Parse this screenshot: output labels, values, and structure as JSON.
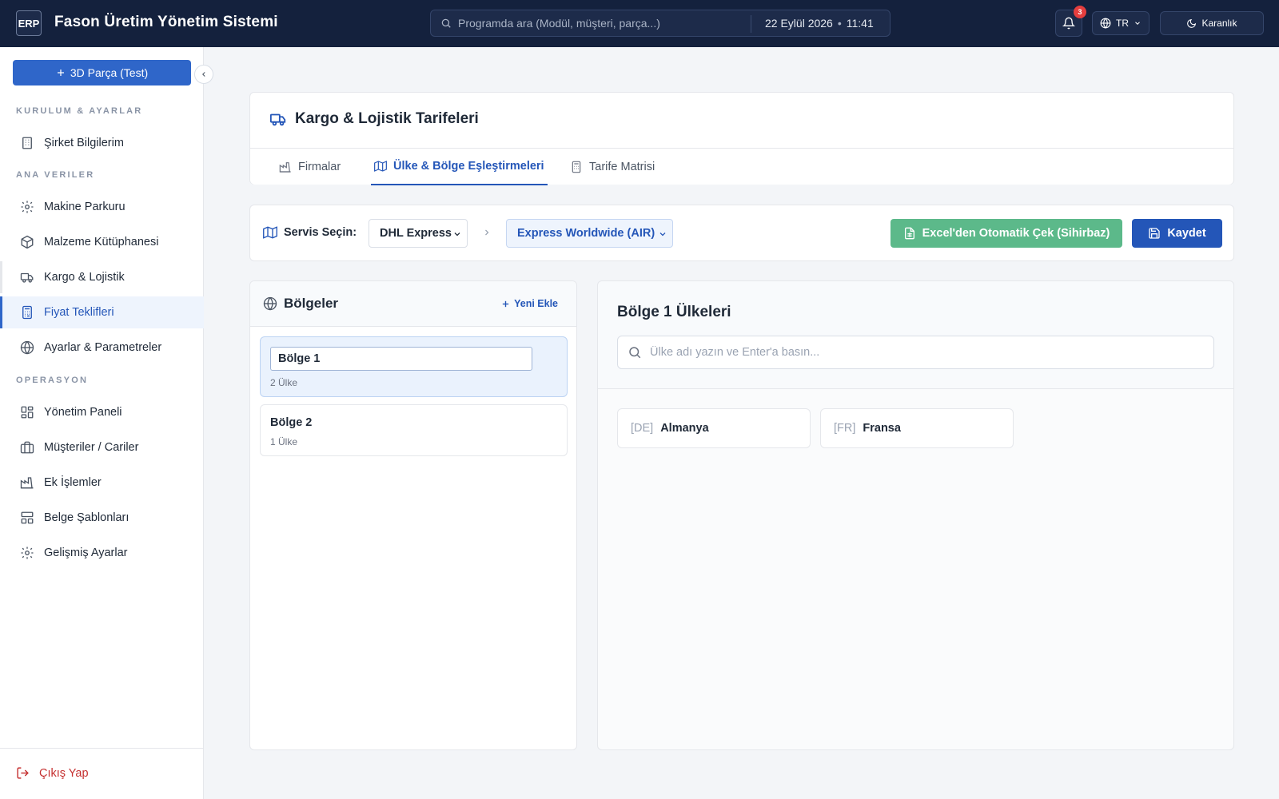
{
  "topbar": {
    "logo": "ERP",
    "app_title": "Fason Üretim Yönetim Sistemi",
    "search_placeholder": "Programda ara (Modül, müşteri, parça...)",
    "date": "22 Eylül 2026",
    "time": "11:41",
    "notification_count": "3",
    "language": "TR",
    "theme_label": "Karanlık"
  },
  "sidebar": {
    "new_part_label": "3D Parça (Test)",
    "sections": {
      "setup": "KURULUM & AYARLAR",
      "master": "ANA VERILER",
      "operation": "OPERASYON"
    },
    "items": [
      {
        "label": "Şirket Bilgilerim",
        "icon": "building-icon"
      },
      {
        "label": "Makine Parkuru",
        "icon": "gear-icon"
      },
      {
        "label": "Malzeme Kütüphanesi",
        "icon": "cube-icon"
      },
      {
        "label": "Kargo & Lojistik",
        "icon": "truck-icon"
      },
      {
        "label": "Fiyat Teklifleri",
        "icon": "calculator-icon"
      },
      {
        "label": "Ayarlar & Parametreler",
        "icon": "globe-icon"
      },
      {
        "label": "Yönetim Paneli",
        "icon": "dashboard-icon"
      },
      {
        "label": "Müşteriler / Cariler",
        "icon": "briefcase-icon"
      },
      {
        "label": "Ek İşlemler",
        "icon": "factory-icon"
      },
      {
        "label": "Belge Şablonları",
        "icon": "template-icon"
      },
      {
        "label": "Gelişmiş Ayarlar",
        "icon": "gear-icon"
      }
    ],
    "logout_label": "Çıkış Yap"
  },
  "page": {
    "title": "Kargo & Lojistik Tarifeleri",
    "tabs": [
      {
        "label": "Firmalar",
        "icon": "factory-icon"
      },
      {
        "label": "Ülke & Bölge Eşleştirmeleri",
        "icon": "map-icon",
        "active": true
      },
      {
        "label": "Tarife Matrisi",
        "icon": "calculator-icon"
      }
    ]
  },
  "toolbar": {
    "service_label": "Servis Seçin:",
    "carrier": "DHL Express",
    "service": "Express Worldwide (AIR)",
    "excel_button": "Excel'den Otomatik Çek (Sihirbaz)",
    "save_button": "Kaydet"
  },
  "regions": {
    "title": "Bölgeler",
    "add_new": "Yeni Ekle",
    "items": [
      {
        "name": "Bölge 1",
        "count": "2 Ülke",
        "selected": true
      },
      {
        "name": "Bölge 2",
        "count": "1 Ülke"
      }
    ]
  },
  "countries": {
    "title": "Bölge 1 Ülkeleri",
    "search_placeholder": "Ülke adı yazın ve Enter'a basın...",
    "items": [
      {
        "code": "[DE]",
        "name": "Almanya"
      },
      {
        "code": "[FR]",
        "name": "Fransa"
      }
    ]
  },
  "colors": {
    "topbar_bg": "#14213d",
    "primary": "#2456b8",
    "success": "#5cb98a",
    "danger": "#c53030",
    "badge": "#e53e3e"
  }
}
